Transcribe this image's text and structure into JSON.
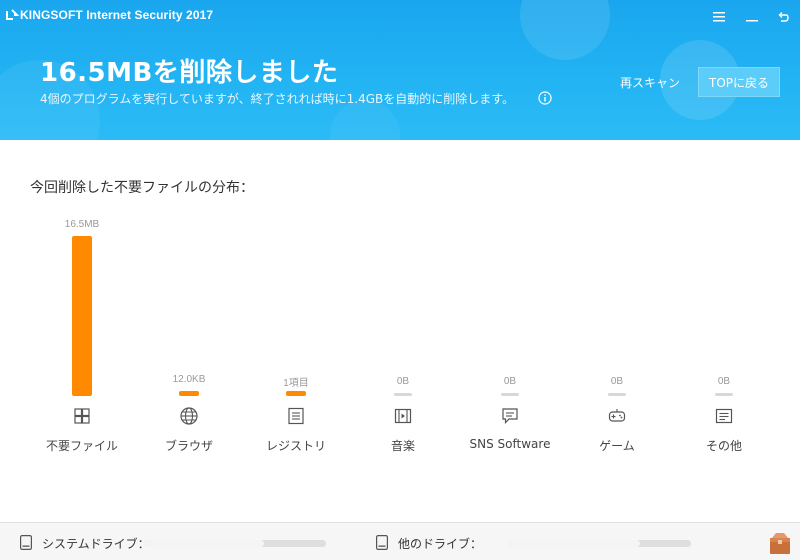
{
  "app": {
    "title": "KINGSOFT Internet Security 2017"
  },
  "window_controls": {
    "menu_icon": "hamburger-icon",
    "minimize_icon": "minimize-icon",
    "close_icon": "back-arrow-icon"
  },
  "header": {
    "headline": "16.5MBを削除しました",
    "subline": "4個のプログラムを実行していますが、終了されれば時に1.4GBを自動的に削除します。",
    "rescan_label": "再スキャン",
    "top_button_label": "TOPに戻る",
    "colors": {
      "gradient_top": "#1aa6ee",
      "gradient_bottom": "#2bbbf6",
      "button_bg": "#5ccdf8"
    }
  },
  "main": {
    "section_title": "今回削除した不要ファイルの分布："
  },
  "chart_data": {
    "type": "bar",
    "title": "今回削除した不要ファイルの分布：",
    "categories": [
      "不要ファイル",
      "ブラウザ",
      "レジストリ",
      "音楽",
      "SNS Software",
      "ゲーム",
      "その他"
    ],
    "value_labels": [
      "16.5MB",
      "12.0KB",
      "1項目",
      "0B",
      "0B",
      "0B",
      "0B"
    ],
    "values": [
      16.5,
      0.0117,
      0,
      0,
      0,
      0,
      0
    ],
    "unit": "MB",
    "icons": [
      "windows-icon",
      "globe-icon",
      "list-icon",
      "film-icon",
      "chat-icon",
      "gamepad-icon",
      "note-icon"
    ],
    "active": [
      true,
      true,
      true,
      false,
      false,
      false,
      false
    ],
    "colors": {
      "active": "#ff8a00",
      "inactive": "#d8d8d8"
    }
  },
  "footer": {
    "system_drive_label": "システムドライブ：",
    "system_drive_usage": 0.66,
    "other_drive_label": "他のドライブ：",
    "other_drive_usage": 0.72,
    "box_icon": "package-icon"
  }
}
